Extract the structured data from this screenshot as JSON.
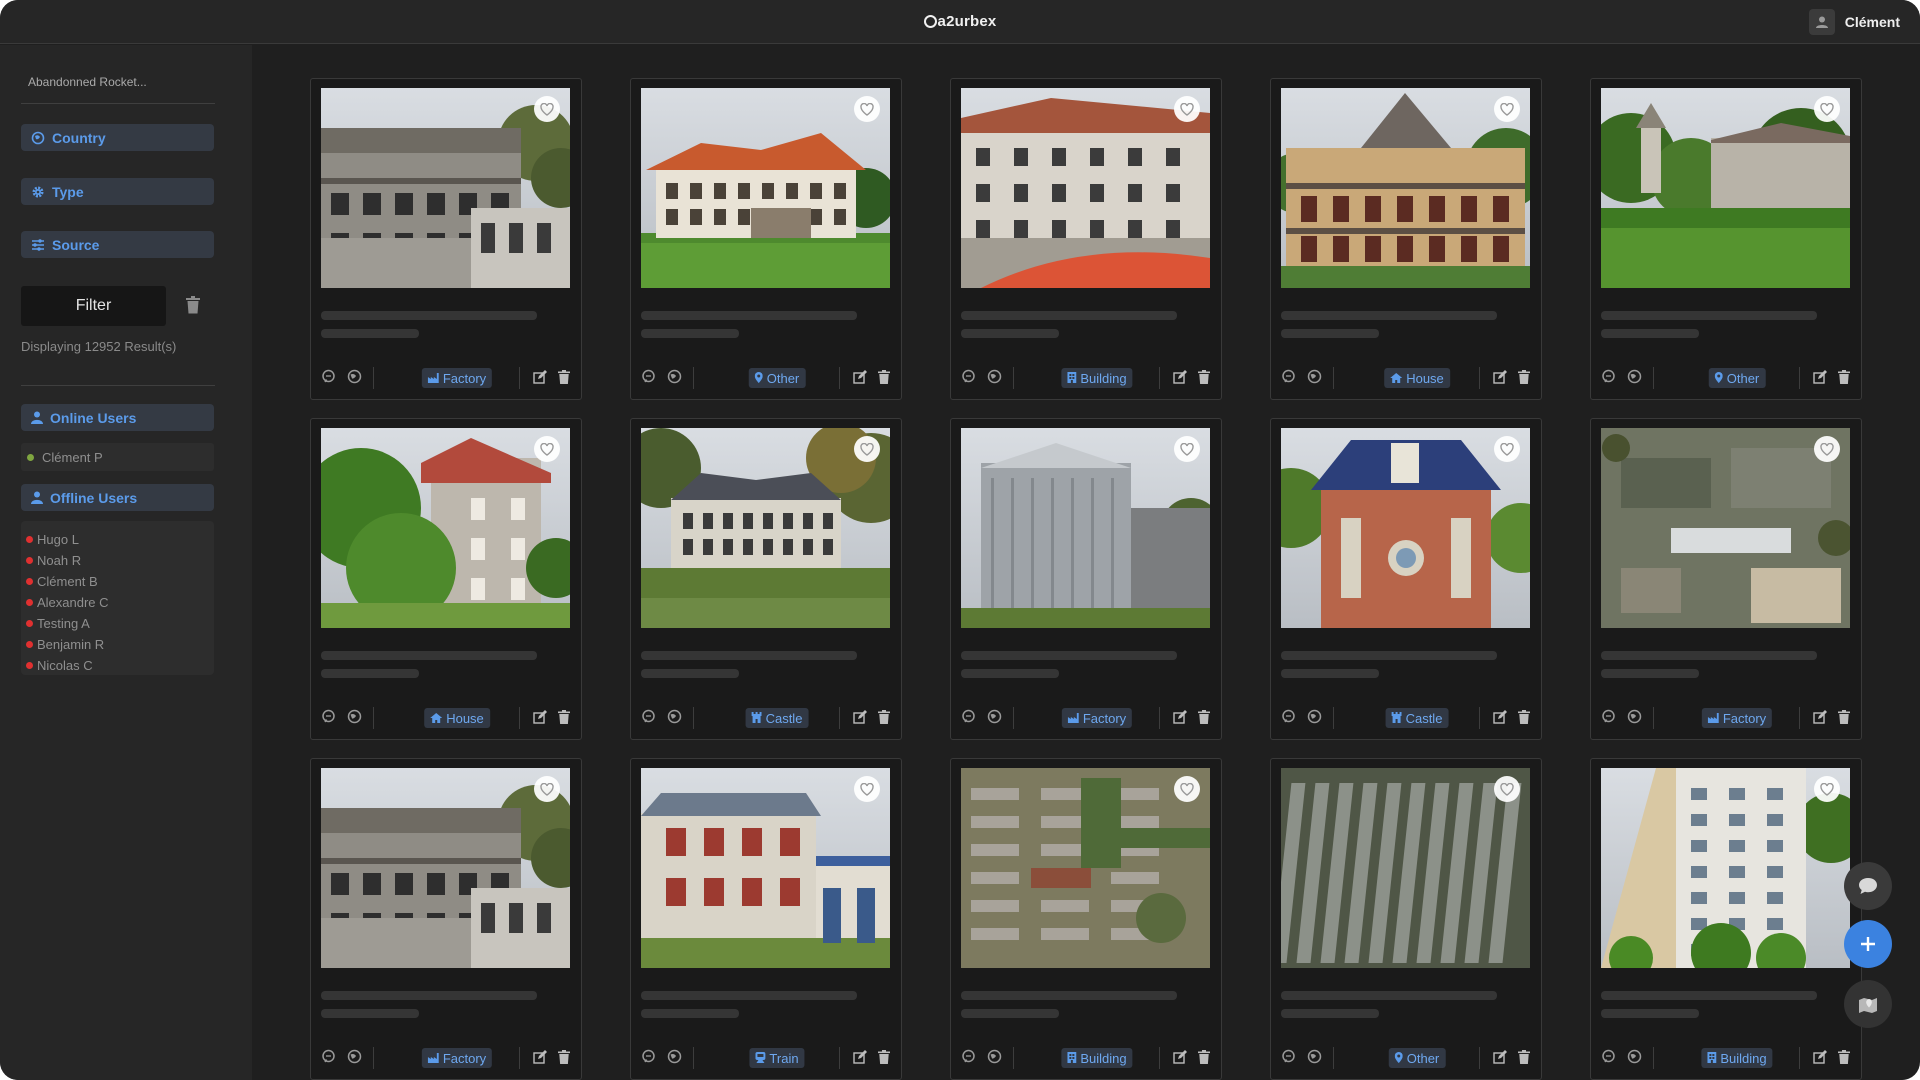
{
  "app": {
    "title": "a2urbex"
  },
  "user": {
    "name": "Clément"
  },
  "sidebar": {
    "search_value": "Abandonned Rocket...",
    "country_label": "Country",
    "type_label": "Type",
    "source_label": "Source",
    "filter_label": "Filter",
    "results_text": "Displaying 12952 Result(s)",
    "online_users_label": "Online Users",
    "online_users": [
      "Clément P"
    ],
    "offline_users_label": "Offline Users",
    "offline_users": [
      "Hugo L",
      "Noah R",
      "Clément B",
      "Alexandre C",
      "Testing A",
      "Benjamin R",
      "Nicolas C"
    ]
  },
  "colors": {
    "accent": "#5b9bea",
    "online": "#7fa640",
    "offline": "#e03030",
    "fab_blue": "#3b82e0"
  },
  "cards": [
    {
      "type": "Factory",
      "type_icon": "factory-icon",
      "image": "Abandoned concrete factory building"
    },
    {
      "type": "Other",
      "type_icon": "pin-icon",
      "image": "Manor with red roof and green lawn"
    },
    {
      "type": "Building",
      "type_icon": "building-icon",
      "image": "Old white mill building with red fence"
    },
    {
      "type": "House",
      "type_icon": "house-icon",
      "image": "Villa with balconies"
    },
    {
      "type": "Other",
      "type_icon": "pin-icon",
      "image": "Overgrown estate with chapel"
    },
    {
      "type": "House",
      "type_icon": "house-icon",
      "image": "House behind trees"
    },
    {
      "type": "Castle",
      "type_icon": "castle-icon",
      "image": "Chateau in the forest"
    },
    {
      "type": "Factory",
      "type_icon": "factory-icon",
      "image": "Metal industrial silo"
    },
    {
      "type": "Castle",
      "type_icon": "castle-icon",
      "image": "Brick pavilion with blue roof"
    },
    {
      "type": "Factory",
      "type_icon": "factory-icon",
      "image": "Aerial view of industrial site"
    },
    {
      "type": "Factory",
      "type_icon": "factory-icon",
      "image": "Abandoned concrete factory building"
    },
    {
      "type": "Train",
      "type_icon": "train-icon",
      "image": "Old train station"
    },
    {
      "type": "Building",
      "type_icon": "building-icon",
      "image": "Aerial view of barracks"
    },
    {
      "type": "Other",
      "type_icon": "pin-icon",
      "image": "Aerial view of rows of sheds"
    },
    {
      "type": "Building",
      "type_icon": "building-icon",
      "image": "Tall white apartment building"
    }
  ]
}
